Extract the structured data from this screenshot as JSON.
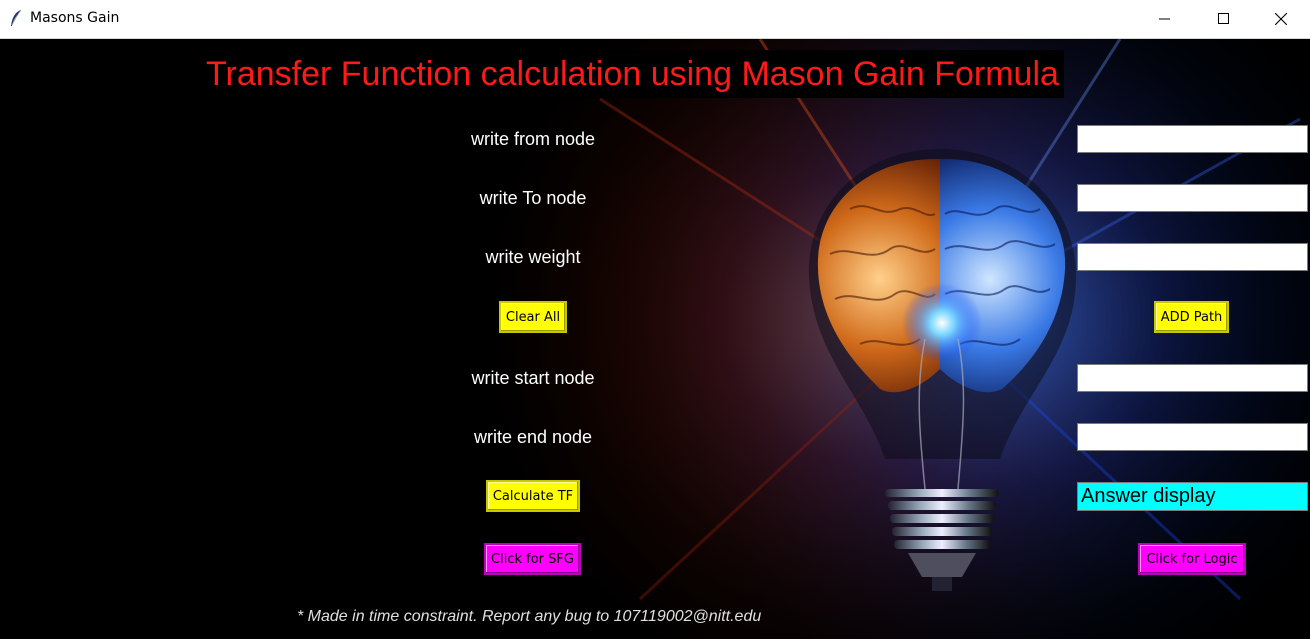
{
  "window": {
    "title": "Masons Gain",
    "controls": {
      "minimize": "minimize-icon",
      "maximize": "maximize-icon",
      "close": "close-icon"
    }
  },
  "heading": "Transfer Function calculation using Mason Gain Formula",
  "fields": {
    "from_node": {
      "label": "write from node",
      "value": ""
    },
    "to_node": {
      "label": "write To node",
      "value": ""
    },
    "weight": {
      "label": "write weight",
      "value": ""
    },
    "start_node": {
      "label": "write start node",
      "value": ""
    },
    "end_node": {
      "label": "write end node",
      "value": ""
    }
  },
  "buttons": {
    "clear_all": "Clear All",
    "add_path": "ADD Path",
    "calculate_tf": "Calculate TF",
    "click_sfg": "Click for SFG",
    "click_logic": "Click for Logic"
  },
  "answer_display": "Answer display",
  "footer": "* Made in time constraint. Report any bug to 107119002@nitt.edu",
  "colors": {
    "heading": "#ff1a1a",
    "button_yellow": "#ffff00",
    "button_magenta": "#ff00ff",
    "answer_bg": "#00ffff",
    "label": "#ffffff",
    "background": "#000000"
  }
}
